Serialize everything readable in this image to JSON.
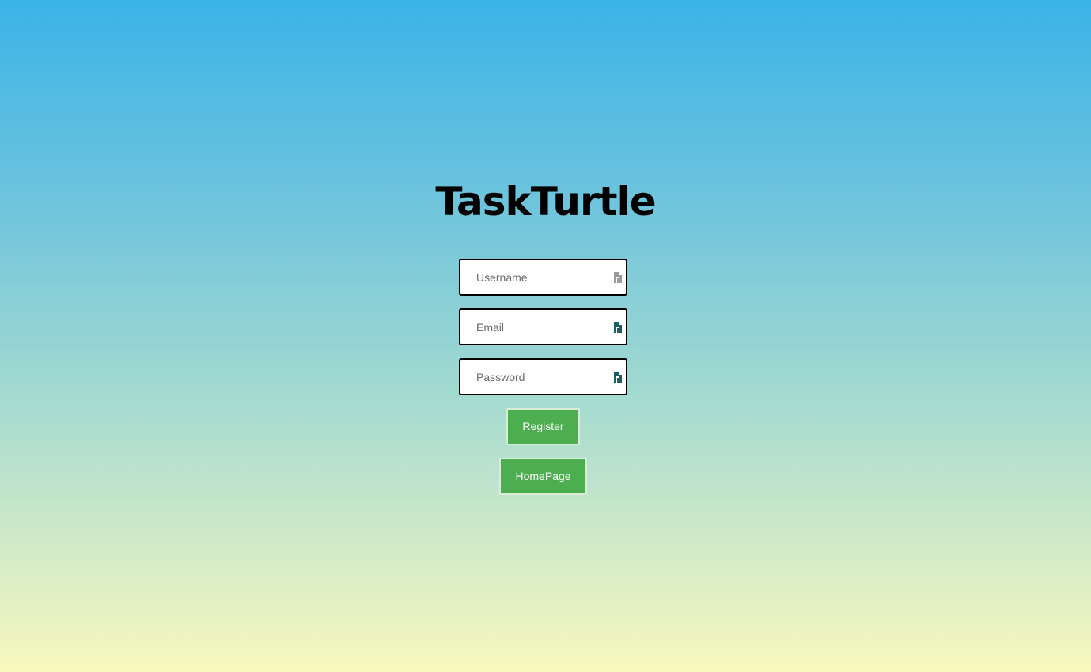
{
  "app": {
    "title": "TaskTurtle"
  },
  "form": {
    "username": {
      "placeholder": "Username",
      "value": ""
    },
    "email": {
      "placeholder": "Email",
      "value": ""
    },
    "password": {
      "placeholder": "Password",
      "value": ""
    }
  },
  "buttons": {
    "register_label": "Register",
    "homepage_label": "HomePage"
  },
  "icons": {
    "username_icon": "password-manager-icon",
    "email_icon": "password-manager-icon",
    "password_icon": "password-manager-icon"
  },
  "colors": {
    "button_bg": "#4cae4f",
    "gradient_top": "#3bb3e7",
    "gradient_bottom": "#f9f8be",
    "icon_muted": "#9a9a9a",
    "icon_active": "#1b5e63"
  }
}
